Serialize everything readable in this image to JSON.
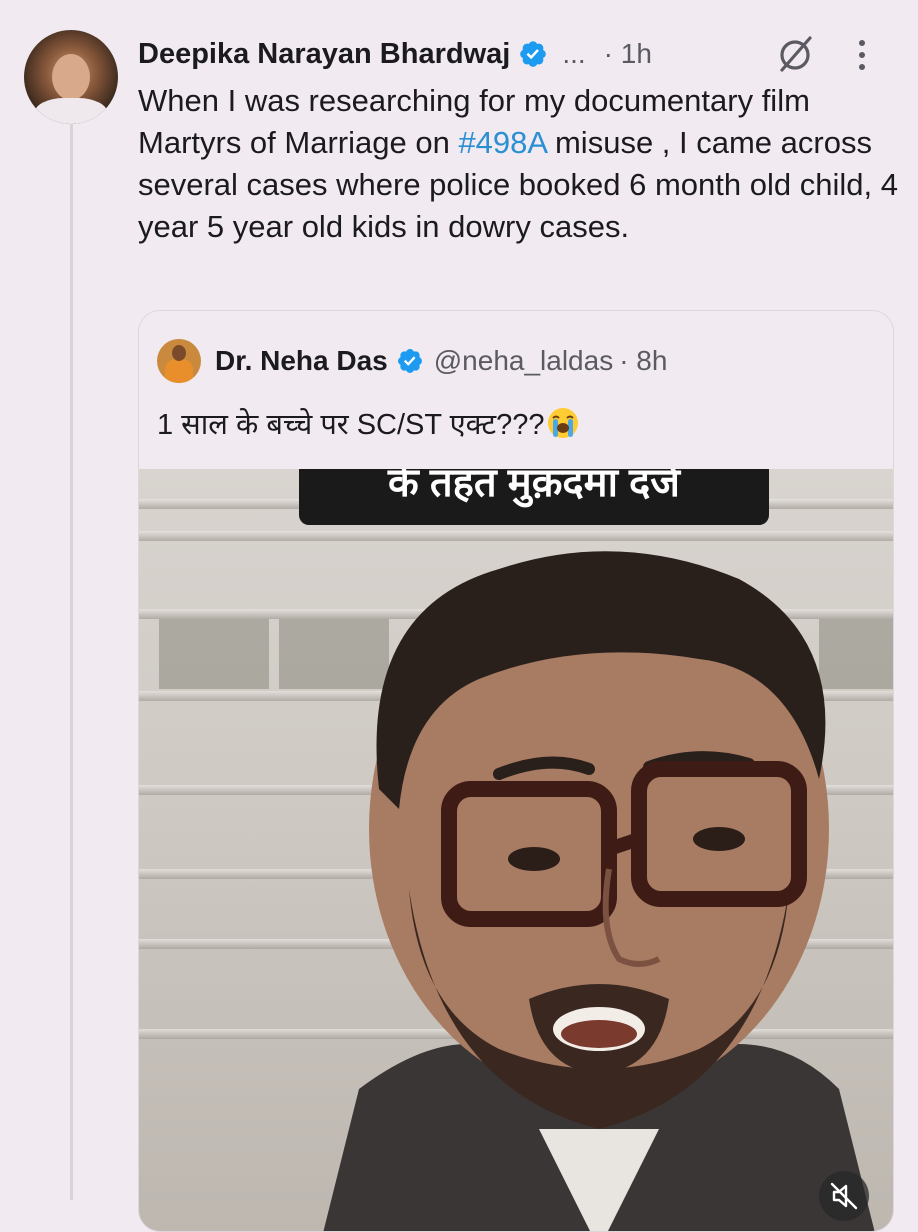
{
  "post": {
    "author_name": "Deepika Narayan Bhardwaj",
    "handle_truncated": "...",
    "time": "· 1h",
    "text_before_hashtag": "When I was researching for my documentary film Martyrs of Marriage on ",
    "hashtag": "#498A",
    "text_after_hashtag": " misuse , I came across several cases where police booked 6 month old child, 4 year 5 year old kids in dowry cases."
  },
  "quote": {
    "author_name": "Dr. Neha Das",
    "handle": "@neha_laldas",
    "time": "· 8h",
    "text": "1 साल के बच्चे पर SC/ST एक्ट???"
  },
  "video": {
    "caption": "के तहत मुक़दमा दर्ज"
  },
  "icons": {
    "verified": "verified-badge-icon",
    "grok": "grok-icon",
    "more": "more-vertical-icon",
    "emoji": "loudly-crying-face-emoji",
    "mute": "muted-speaker-icon"
  },
  "colors": {
    "background": "#f1eaf0",
    "hashtag": "#2a8fd3",
    "verified": "#1d9bf0",
    "muted_text": "#5b5a63"
  }
}
